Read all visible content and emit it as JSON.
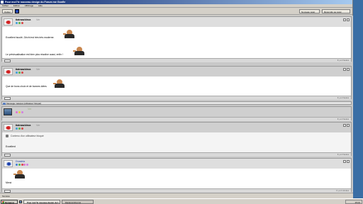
{
  "window": {
    "title": "Pour moi?le nouveau design du Forum me Gonfle",
    "menu": [
      "Fichier",
      "Edition",
      "Affichage",
      "Aide"
    ]
  },
  "toolbar": {
    "back_label": "Quitter",
    "new_label": "Nouveau sujet",
    "reply_label": "Répondre au sujet"
  },
  "posts": [
    {
      "username": "tiatraazbiroa",
      "badge": "Ver",
      "lines": [
        "Excellent tsoolé, Grichi est très trés moderne.",
        "Le prévisualisation est bien plus réactive aussi, enfin !"
      ],
      "time": "Il y a 2 heures"
    },
    {
      "username": "tiatraazbiroa",
      "badge": "Ver",
      "lines": [
        "Que de bons choix et de bonnes idées"
      ],
      "time": "Il y a 2 heures"
    },
    {
      "username": "",
      "badge": "Ver",
      "lines": [],
      "time": "Il y a 2 heures"
    },
    {
      "username": "tiatraazbiroa",
      "badge": "Ver",
      "lines": [
        "Excellent"
      ],
      "hidden_notice": "Contenu d'un utilisateur bloqué",
      "time": "Il y a 2 heures"
    },
    {
      "username": "Dnasbla",
      "badge": "",
      "lines": [
        "Merci"
      ],
      "time": "Il y a 2 minutes"
    }
  ],
  "notice_bar": "Message masqué (utilisateur bloqué)",
  "statusbar": "Terminé",
  "taskbar": {
    "start_label": "Démarrer",
    "tasks": [
      "Pour moi?le nouveau design du f...",
      "ilitedemorpha.img"
    ],
    "clock": "15:04"
  },
  "colors": {
    "titlebar": "#0a246a",
    "window_bg": "#d4d0c8",
    "desktop": "#3a6ea5",
    "post_head": "#dedede",
    "username_blue": "#1c3fa8"
  }
}
